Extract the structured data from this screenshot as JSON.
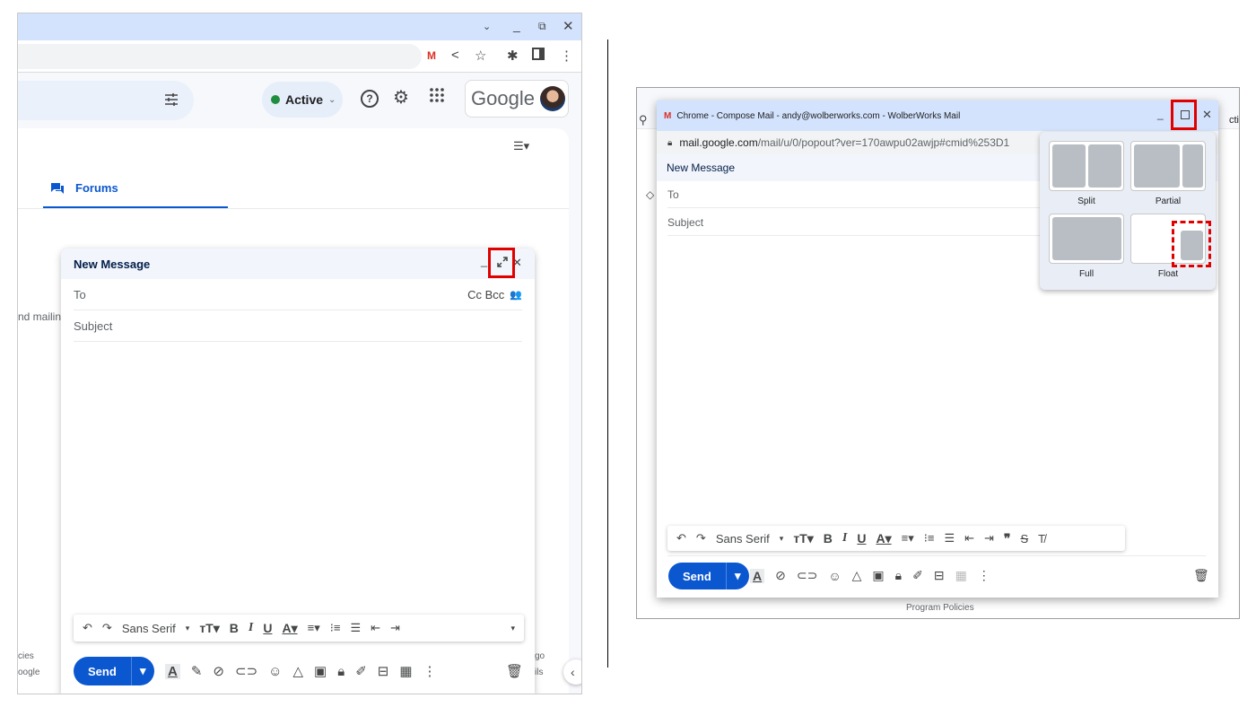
{
  "left": {
    "status": {
      "label": "Active"
    },
    "google_logo": "Google",
    "tab": {
      "label": "Forums"
    },
    "snippet_left": "nd mailing",
    "footer_left": [
      "cies",
      "oogle"
    ],
    "footer_right": [
      "go",
      "ils"
    ],
    "compose": {
      "title": "New Message",
      "to_label": "To",
      "cc_bcc": "Cc Bcc",
      "subject_placeholder": "Subject",
      "font": "Sans Serif",
      "send_label": "Send"
    }
  },
  "right": {
    "window_title": "Chrome - Compose Mail - andy@wolberworks.com - WolberWorks Mail",
    "url_host": "mail.google.com",
    "url_path": "/mail/u/0/popout?ver=170awpu02awjp#cmid%253D1",
    "behind_text": "ctiv",
    "compose": {
      "title": "New Message",
      "to_label": "To",
      "subject_placeholder": "Subject",
      "font": "Sans Serif",
      "send_label": "Send"
    },
    "layout_menu": {
      "options": [
        "Split",
        "Partial",
        "Full",
        "Float"
      ]
    },
    "footer": "Program Policies"
  },
  "colors": {
    "highlight": "#e00000",
    "primary": "#0b57d0",
    "active_dot": "#1e8e3e"
  }
}
